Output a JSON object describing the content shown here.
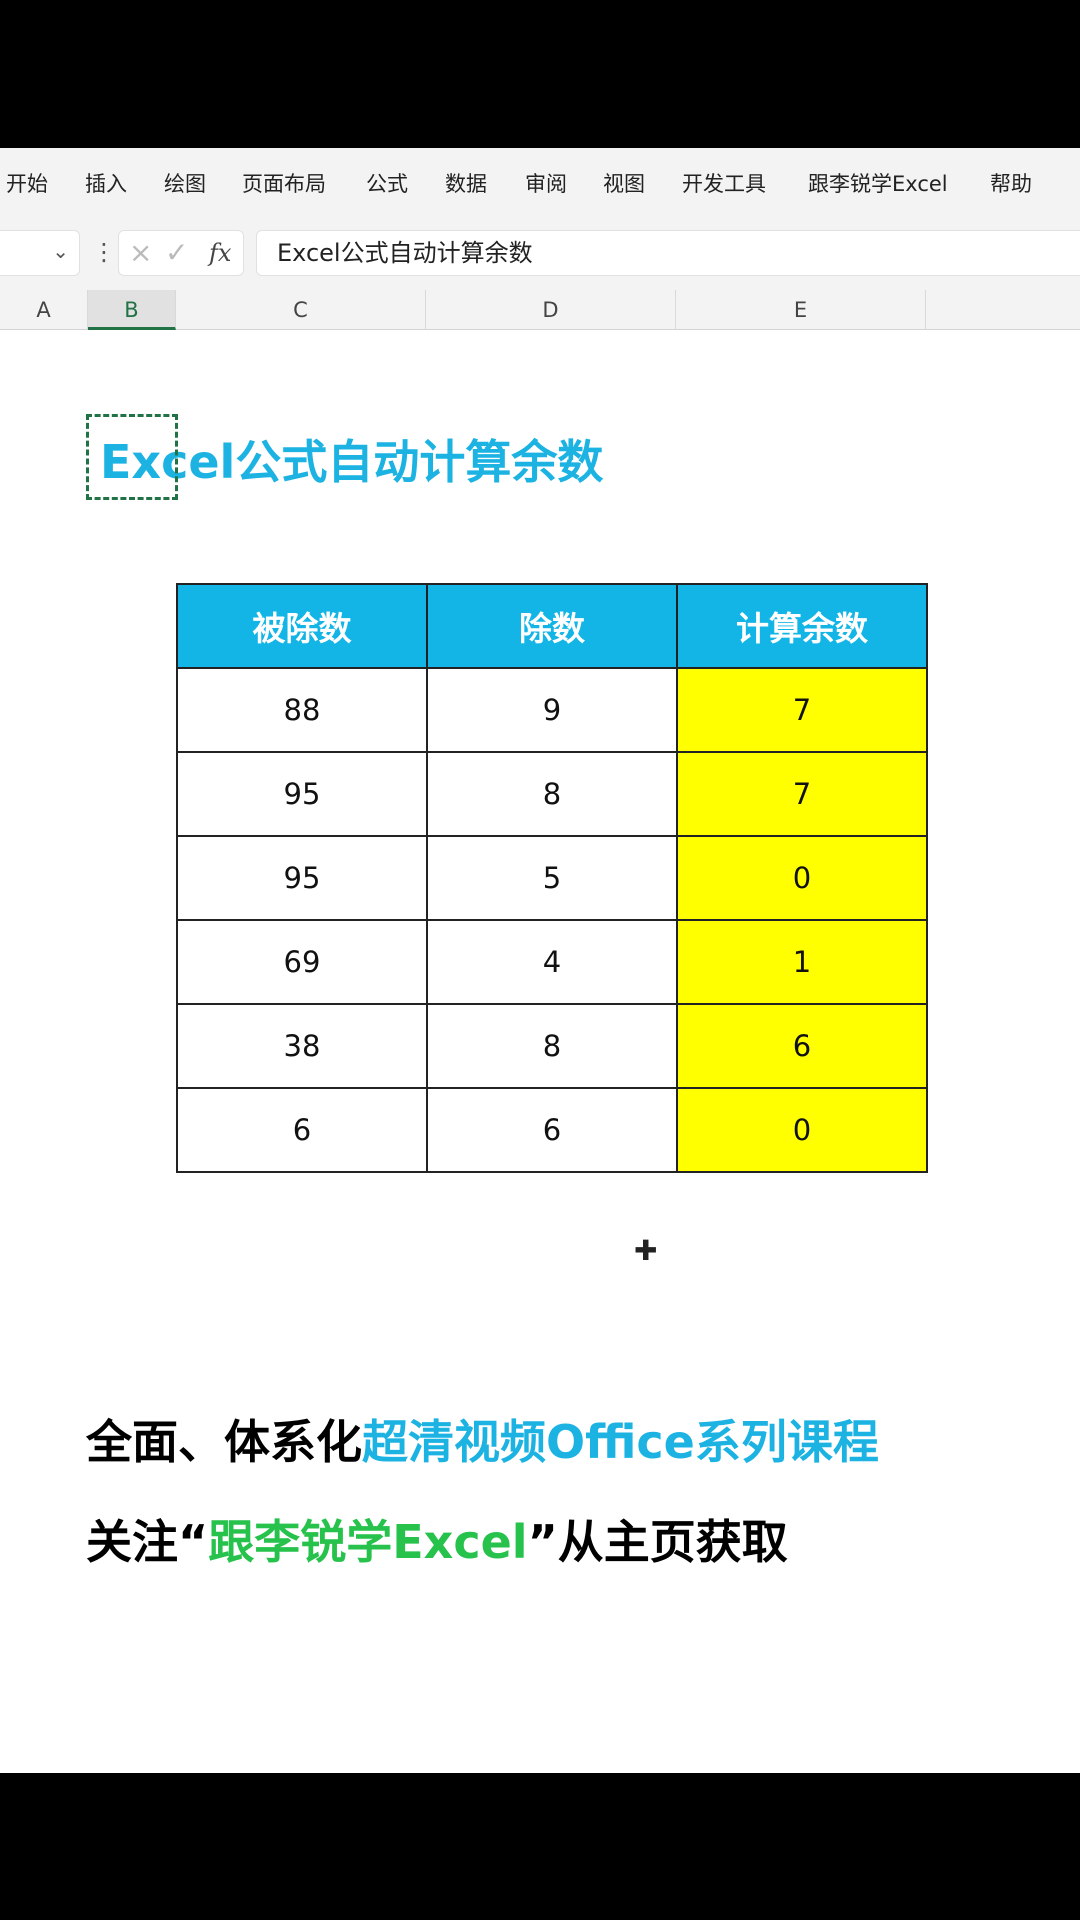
{
  "ribbon": {
    "tabs": [
      "开始",
      "插入",
      "绘图",
      "页面布局",
      "公式",
      "数据",
      "审阅",
      "视图",
      "开发工具",
      "跟李锐学Excel",
      "帮助"
    ]
  },
  "formula_bar": {
    "cancel_icon": "×",
    "enter_icon": "✓",
    "fx_label": "fx",
    "content": "Excel公式自动计算余数"
  },
  "columns": [
    "A",
    "B",
    "C",
    "D",
    "E"
  ],
  "active_column": "B",
  "sheet": {
    "title": "Excel公式自动计算余数",
    "table": {
      "headers": [
        "被除数",
        "除数",
        "计算余数"
      ],
      "rows": [
        [
          "88",
          "9",
          "7"
        ],
        [
          "95",
          "8",
          "7"
        ],
        [
          "95",
          "5",
          "0"
        ],
        [
          "69",
          "4",
          "1"
        ],
        [
          "38",
          "8",
          "6"
        ],
        [
          "6",
          "6",
          "0"
        ]
      ]
    }
  },
  "promo": {
    "line1_black": "全面、体系化",
    "line1_blue": "超清视频Office系列课程",
    "line2_black_a": "关注“",
    "line2_green": "跟李锐学Excel",
    "line2_black_b": "”从主页获取"
  },
  "colors": {
    "accent_blue": "#1cb3e3",
    "header_fill": "#12b5e5",
    "result_fill": "#ffff00",
    "promo_green": "#27c24c",
    "excel_green": "#217346"
  }
}
